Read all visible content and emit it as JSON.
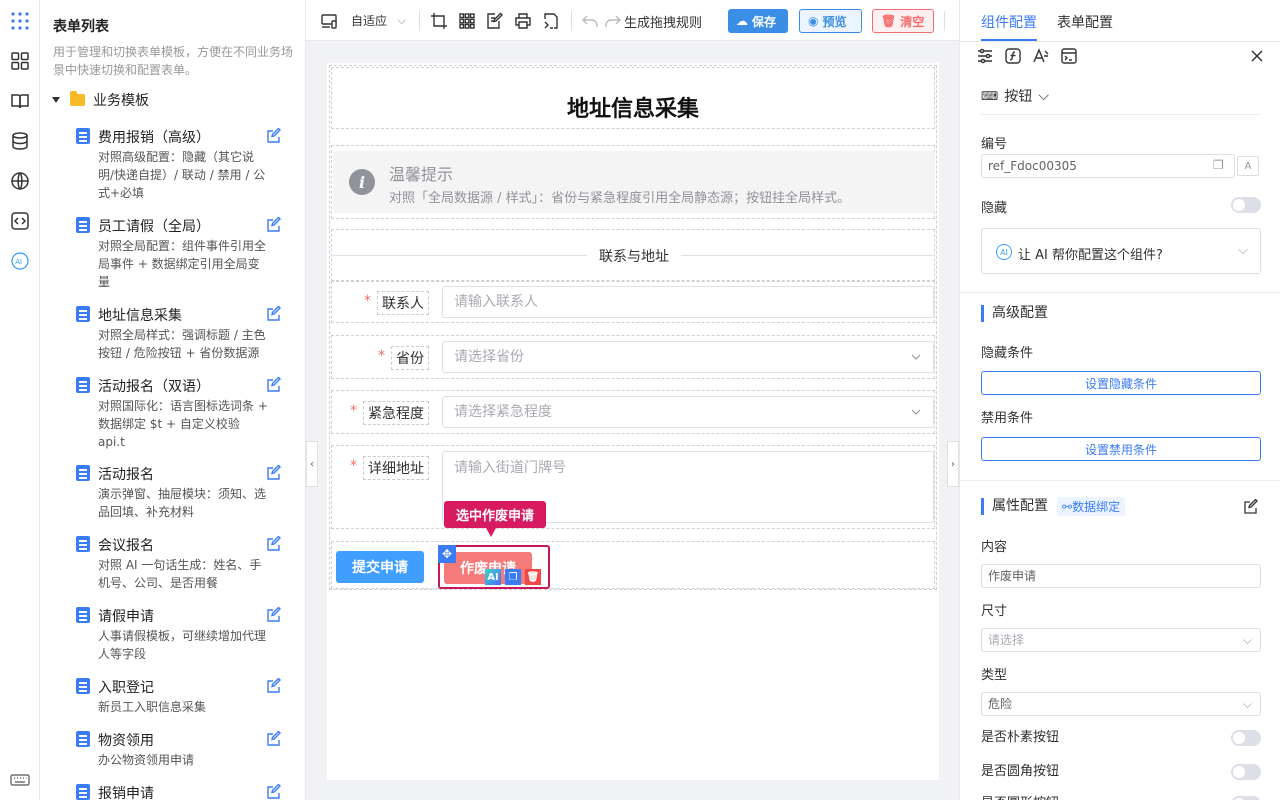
{
  "rail": {
    "icons": [
      "apps-grid-icon",
      "components-icon",
      "book-icon",
      "database-icon",
      "globe-icon",
      "code-icon",
      "ai-icon",
      "keyboard-icon"
    ]
  },
  "left": {
    "title": "表单列表",
    "desc": "用于管理和切换表单模板，方便在不同业务场景中快速切换和配置表单。",
    "group": "业务模板",
    "items": [
      {
        "name": "费用报销（高级）",
        "desc": "对照高级配置：隐藏（其它说明/快递自提）/ 联动 / 禁用 / 公式+必填"
      },
      {
        "name": "员工请假（全局）",
        "desc": "对照全局配置：组件事件引用全局事件 + 数据绑定引用全局变量"
      },
      {
        "name": "地址信息采集",
        "desc": "对照全局样式：强调标题 / 主色按钮 / 危险按钮 + 省份数据源"
      },
      {
        "name": "活动报名（双语）",
        "desc": "对照国际化：语言图标选词条 + 数据绑定 $t + 自定义校验 api.t"
      },
      {
        "name": "活动报名",
        "desc": "演示弹窗、抽屉模块：须知、选品回填、补充材料"
      },
      {
        "name": "会议报名",
        "desc": "对照 AI 一句话生成：姓名、手机号、公司、是否用餐"
      },
      {
        "name": "请假申请",
        "desc": "人事请假模板，可继续增加代理人等字段"
      },
      {
        "name": "入职登记",
        "desc": "新员工入职信息采集"
      },
      {
        "name": "物资领用",
        "desc": "办公物资领用申请"
      },
      {
        "name": "报销申请",
        "desc": ""
      }
    ]
  },
  "toolbar": {
    "adapt": "自适应",
    "gen_rule": "生成拖拽规则",
    "save": "保存",
    "preview": "预览",
    "clear": "清空"
  },
  "form": {
    "title": "地址信息采集",
    "tip_title": "温馨提示",
    "tip_desc": "对照「全局数据源 / 样式」：省份与紧急程度引用全局静态源；按钮挂全局样式。",
    "section": "联系与地址",
    "fields": [
      {
        "label": "联系人",
        "placeholder": "请输入联系人"
      },
      {
        "label": "省份",
        "placeholder": "请选择省份"
      },
      {
        "label": "紧急程度",
        "placeholder": "请选择紧急程度"
      },
      {
        "label": "详细地址",
        "placeholder": "请输入街道门牌号"
      }
    ],
    "submit": "提交申请",
    "void": "作废申请",
    "selected_tip": "选中作废申请",
    "ai_badge": "AI"
  },
  "right": {
    "tab_component": "组件配置",
    "tab_form": "表单配置",
    "type_label": "按钮",
    "id_label": "编号",
    "id_value": "ref_Fdoc00305",
    "hidden_label": "隐藏",
    "ai_help": "让 AI 帮你配置这个组件?",
    "ai_icon_text": "AI",
    "adv_title": "高级配置",
    "hide_cond": "隐藏条件",
    "set_hide": "设置隐藏条件",
    "disable_cond": "禁用条件",
    "set_disable": "设置禁用条件",
    "prop_title": "属性配置",
    "bind": "数据绑定",
    "content_label": "内容",
    "content_value": "作废申请",
    "size_label": "尺寸",
    "size_placeholder": "请选择",
    "type_field_label": "类型",
    "type_value": "危险",
    "plain_label": "是否朴素按钮",
    "round_label": "是否圆角按钮",
    "circle_label": "是否圆形按钮"
  },
  "colors": {
    "primary": "#3a7cf5",
    "danger": "#f56c6c",
    "select": "#d81b60"
  }
}
